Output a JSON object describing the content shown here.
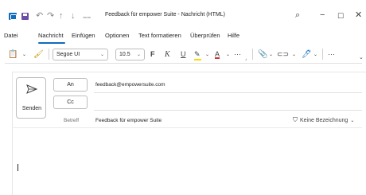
{
  "window": {
    "title": "Feedback für empower Suite  -  Nachricht (HTML)"
  },
  "menu": {
    "tabs": [
      "Datei",
      "Nachricht",
      "Einfügen",
      "Optionen",
      "Text formatieren",
      "Überprüfen",
      "Hilfe"
    ],
    "active_tab": "Nachricht"
  },
  "ribbon": {
    "font_name": "Segoe UI",
    "font_size": "10.5",
    "bold": "F",
    "italic": "K",
    "underline": "U",
    "font_color_letter": "A",
    "more": "···",
    "more2": "···",
    "highlight_color": "#ffd700",
    "font_color": "#d13438"
  },
  "compose": {
    "send_label": "Senden",
    "to_label": "An",
    "cc_label": "Cc",
    "to_value": "feedback@empowersuite.com",
    "cc_value": "",
    "subject_label": "Betreff",
    "subject_value": "Feedback für empower Suite",
    "sensitivity_label": "Keine Bezeichnung"
  },
  "colors": {
    "accent": "#0f6cbd"
  }
}
